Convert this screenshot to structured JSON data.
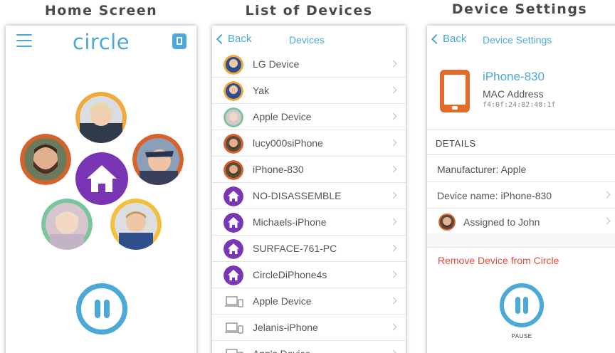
{
  "captions": {
    "home": "Home Screen",
    "list": "List of Devices",
    "settings": "Device Settings"
  },
  "home_screen": {
    "logo": "circle",
    "colors": {
      "accent": "#4aa9d8",
      "home": "#7a35b5"
    }
  },
  "devices_screen": {
    "back": "Back",
    "title": "Devices",
    "devices": [
      {
        "label": "LG Device",
        "icon": "avatar-blue-orange"
      },
      {
        "label": "Yak",
        "icon": "avatar-blue-orange"
      },
      {
        "label": "Apple Device",
        "icon": "avatar-green-pink"
      },
      {
        "label": "lucy000siPhone",
        "icon": "avatar-brown-orange"
      },
      {
        "label": "iPhone-830",
        "icon": "avatar-brown-orange"
      },
      {
        "label": "NO-DISASSEMBLE",
        "icon": "home-purple"
      },
      {
        "label": "Michaels-iPhone",
        "icon": "home-purple"
      },
      {
        "label": "SURFACE-761-PC",
        "icon": "home-purple"
      },
      {
        "label": "CircleDiPhone4s",
        "icon": "home-purple"
      },
      {
        "label": "Apple Device",
        "icon": "laptop-gray"
      },
      {
        "label": "Jelanis-iPhone",
        "icon": "laptop-gray"
      },
      {
        "label": "App's Device",
        "icon": "laptop-gray"
      }
    ]
  },
  "settings_screen": {
    "back": "Back",
    "title": "Device Settings",
    "device_name": "iPhone-830",
    "mac_label": "MAC Address",
    "mac_value": "f4:0f:24:82:48:1f",
    "details_header": "DETAILS",
    "manufacturer": "Manufacturer: Apple",
    "device_name_row": "Device name: iPhone-830",
    "assigned": "Assigned to John",
    "remove": "Remove Device from Circle",
    "pause_label": "PAUSE"
  }
}
